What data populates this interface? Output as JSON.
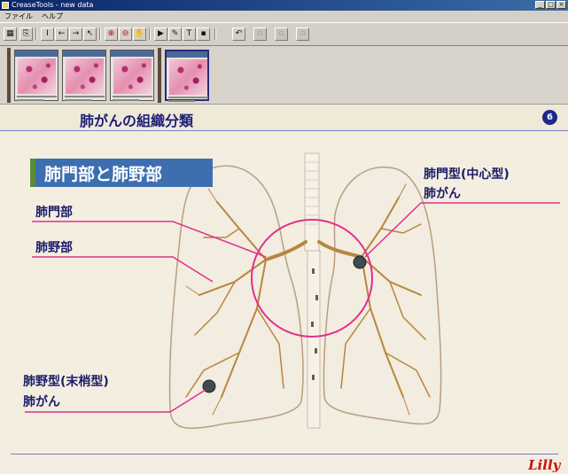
{
  "window": {
    "title": "CreaseTools - new data",
    "min_label": "_",
    "max_label": "□",
    "close_label": "×"
  },
  "menu": {
    "items": [
      "ファイル",
      "ヘルプ"
    ]
  },
  "toolbar": {
    "tools": [
      {
        "name": "grid-icon",
        "glyph": "▦"
      },
      {
        "name": "copy-icon",
        "glyph": "⎘"
      },
      {
        "name": "cursor-icon",
        "glyph": "I"
      },
      {
        "name": "arrow-left-icon",
        "glyph": "←"
      },
      {
        "name": "arrow-right-icon",
        "glyph": "→"
      },
      {
        "name": "pointer-icon",
        "glyph": "↖"
      },
      {
        "name": "zoom-in-icon",
        "glyph": "⊕"
      },
      {
        "name": "zoom-out-icon",
        "glyph": "⊖"
      },
      {
        "name": "hand-icon",
        "glyph": "✋"
      },
      {
        "name": "select-icon",
        "glyph": "▶"
      },
      {
        "name": "pen-icon",
        "glyph": "✎"
      },
      {
        "name": "text-icon",
        "glyph": "T"
      },
      {
        "name": "fill-icon",
        "glyph": "▪"
      },
      {
        "name": "undo-icon",
        "glyph": "↶"
      },
      {
        "name": "disabled-tool-1-icon",
        "glyph": "▫"
      },
      {
        "name": "disabled-tool-2-icon",
        "glyph": "▫"
      },
      {
        "name": "disabled-tool-3-icon",
        "glyph": "▫"
      }
    ]
  },
  "thumbnails": {
    "count": 4,
    "selected_index": 3
  },
  "slide": {
    "title": "肺がんの組織分類",
    "page_number": "6",
    "subtitle": "肺門部と肺野部",
    "labels": {
      "hilar_region": "肺門部",
      "peripheral_region": "肺野部",
      "central_type_line1": "肺門型(中心型)",
      "central_type_line2": "肺がん",
      "peripheral_type_line1": "肺野型(末梢型)",
      "peripheral_type_line2": "肺がん"
    },
    "logo_text": "Lilly",
    "colors": {
      "title": "#1e1e78",
      "subtitle_bg": "#3d6eb0",
      "leader_line": "#e0308a",
      "lung_fill": "#f3ece0",
      "bronchi": "#b7873e"
    }
  }
}
